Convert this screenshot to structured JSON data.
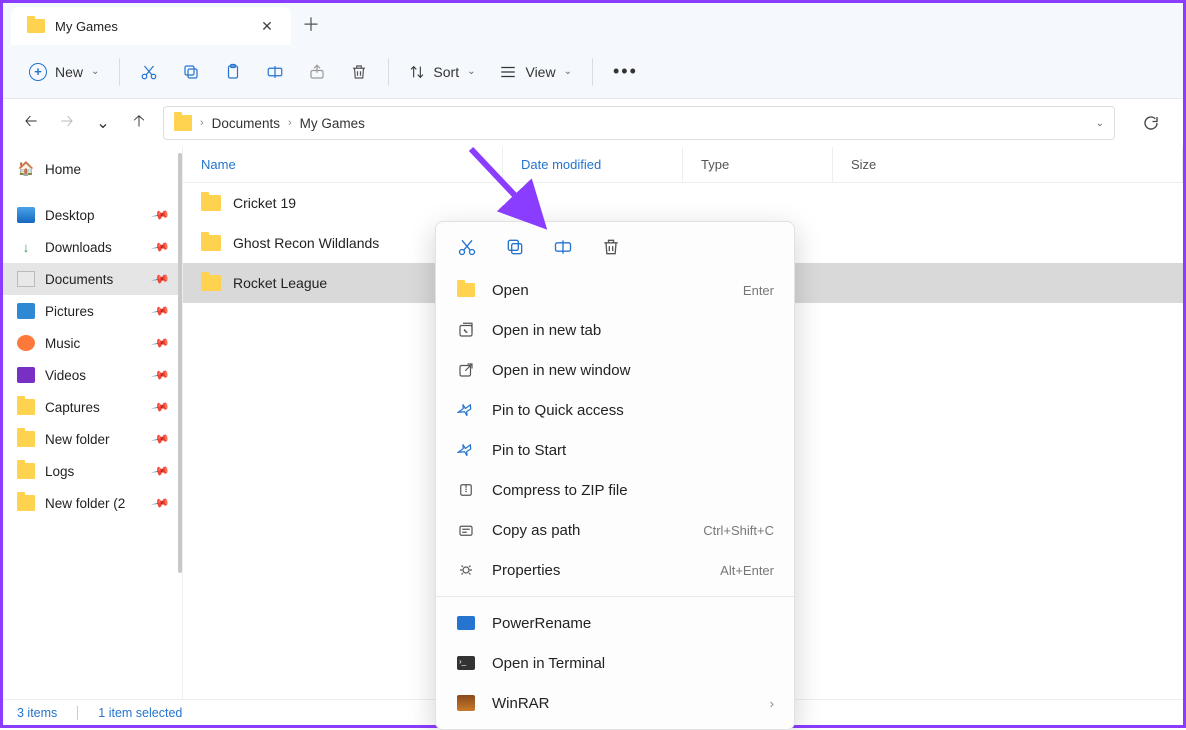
{
  "tab": {
    "title": "My Games"
  },
  "toolbar": {
    "new_label": "New",
    "sort_label": "Sort",
    "view_label": "View"
  },
  "breadcrumb": {
    "parts": [
      "Documents",
      "My Games"
    ]
  },
  "sidebar": {
    "items": [
      {
        "label": "Home",
        "icon": "home",
        "pinned": false,
        "selected": false
      },
      {
        "label": "Desktop",
        "icon": "desktop",
        "pinned": true,
        "selected": false
      },
      {
        "label": "Downloads",
        "icon": "download",
        "pinned": true,
        "selected": false
      },
      {
        "label": "Documents",
        "icon": "doc",
        "pinned": true,
        "selected": true
      },
      {
        "label": "Pictures",
        "icon": "picture",
        "pinned": true,
        "selected": false
      },
      {
        "label": "Music",
        "icon": "music",
        "pinned": true,
        "selected": false
      },
      {
        "label": "Videos",
        "icon": "video",
        "pinned": true,
        "selected": false
      },
      {
        "label": "Captures",
        "icon": "folder",
        "pinned": true,
        "selected": false
      },
      {
        "label": "New folder",
        "icon": "folder",
        "pinned": true,
        "selected": false
      },
      {
        "label": "Logs",
        "icon": "folder",
        "pinned": true,
        "selected": false
      },
      {
        "label": "New folder (2",
        "icon": "folder",
        "pinned": true,
        "selected": false
      }
    ]
  },
  "columns": {
    "name": "Name",
    "date": "Date modified",
    "type": "Type",
    "size": "Size"
  },
  "files": [
    {
      "name": "Cricket 19",
      "selected": false
    },
    {
      "name": "Ghost Recon Wildlands",
      "selected": false
    },
    {
      "name": "Rocket League",
      "selected": true
    }
  ],
  "context_menu": {
    "items": [
      {
        "label": "Open",
        "shortcut": "Enter",
        "icon": "folder"
      },
      {
        "label": "Open in new tab",
        "icon": "newtab"
      },
      {
        "label": "Open in new window",
        "icon": "external"
      },
      {
        "label": "Pin to Quick access",
        "icon": "pin"
      },
      {
        "label": "Pin to Start",
        "icon": "pin"
      },
      {
        "label": "Compress to ZIP file",
        "icon": "zip"
      },
      {
        "label": "Copy as path",
        "shortcut": "Ctrl+Shift+C",
        "icon": "copypath"
      },
      {
        "label": "Properties",
        "shortcut": "Alt+Enter",
        "icon": "properties"
      }
    ],
    "extra": [
      {
        "label": "PowerRename",
        "icon": "powerrename"
      },
      {
        "label": "Open in Terminal",
        "icon": "terminal"
      },
      {
        "label": "WinRAR",
        "icon": "winrar",
        "submenu": true
      }
    ]
  },
  "status": {
    "count": "3 items",
    "selection": "1 item selected"
  }
}
